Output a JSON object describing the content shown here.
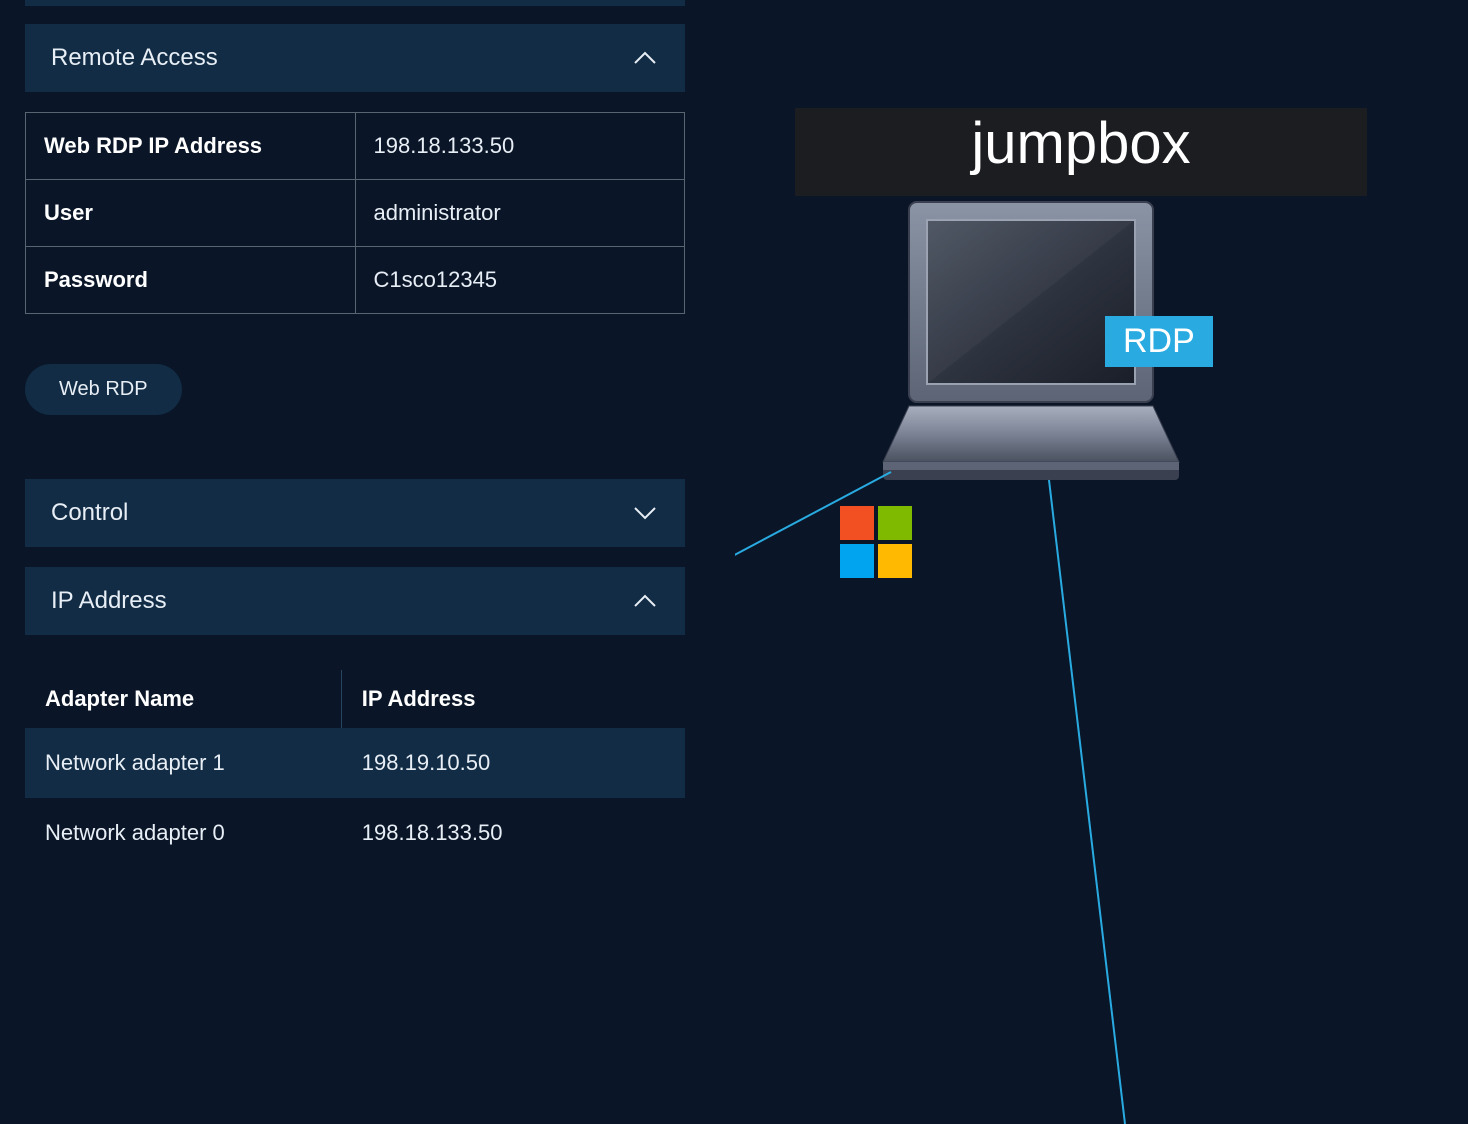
{
  "panels": {
    "remote_access": {
      "title": "Remote Access",
      "expanded": true,
      "credentials": [
        {
          "label": "Web RDP IP Address",
          "value": "198.18.133.50"
        },
        {
          "label": "User",
          "value": "administrator"
        },
        {
          "label": "Password",
          "value": "C1sco12345"
        }
      ],
      "button_label": "Web RDP"
    },
    "control": {
      "title": "Control",
      "expanded": false
    },
    "ip_address": {
      "title": "IP Address",
      "expanded": true,
      "columns": {
        "name": "Adapter Name",
        "ip": "IP Address"
      },
      "rows": [
        {
          "name": "Network adapter 1",
          "ip": "198.19.10.50"
        },
        {
          "name": "Network adapter 0",
          "ip": "198.18.133.50"
        }
      ]
    }
  },
  "diagram": {
    "node_title": "jumpbox",
    "badge": "RDP",
    "os_icon": "windows"
  }
}
